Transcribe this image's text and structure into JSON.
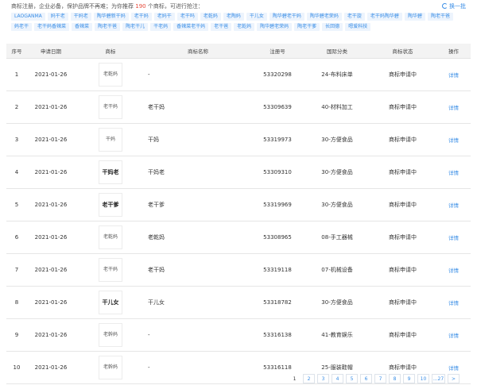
{
  "header": {
    "notice_prefix": "商标注册，企业必备，保护品牌不再难；为你推荐",
    "notice_count": "190",
    "notice_suffix": "个商标，可进行抢注：",
    "refresh_label": "换一批"
  },
  "tags": [
    [
      "LAOGANMA",
      "妈干老",
      "干妈老",
      "陶华碧新干妈",
      "老干妈",
      "老妈干",
      "老干吗",
      "老乾妈",
      "老陶妈",
      "干儿女",
      "陶华碧老干妈",
      "陶华碧老荣妈",
      "老干旋",
      "老干妈陶华碧",
      "陶华碧",
      "陶老干爸"
    ],
    [
      "妈老干",
      "老干妈香辣菜",
      "香辣菜",
      "陶老干爸",
      "陶老干儿",
      "干老妈",
      "香辣菜老干妈",
      "老干爸",
      "老乾妈",
      "陶华碧老荣妈",
      "陶老干爹",
      "长回德",
      "嗯爱科技"
    ]
  ],
  "table": {
    "columns": [
      "序号",
      "申请日期",
      "商标",
      "商标名称",
      "注册号",
      "国际分类",
      "商标状态",
      "操作"
    ],
    "rows": [
      {
        "idx": "1",
        "date": "2021-01-26",
        "logo": "老乾妈",
        "name": "-",
        "reg": "53320298",
        "cls": "24-布料床单",
        "status": "商标申请中",
        "op": "详情"
      },
      {
        "idx": "2",
        "date": "2021-01-26",
        "logo": "老干妈",
        "name": "老干妈",
        "reg": "53309639",
        "cls": "40-材料加工",
        "status": "商标申请中",
        "op": "详情"
      },
      {
        "idx": "3",
        "date": "2021-01-26",
        "logo": "干妈",
        "name": "干妈",
        "reg": "53319973",
        "cls": "30-方便食品",
        "status": "商标申请中",
        "op": "详情"
      },
      {
        "idx": "4",
        "date": "2021-01-26",
        "logo": "干妈老",
        "name": "干妈老",
        "reg": "53309310",
        "cls": "30-方便食品",
        "status": "商标申请中",
        "op": "详情"
      },
      {
        "idx": "5",
        "date": "2021-01-26",
        "logo": "老干爹",
        "name": "老干爹",
        "reg": "53319969",
        "cls": "30-方便食品",
        "status": "商标申请中",
        "op": "详情"
      },
      {
        "idx": "6",
        "date": "2021-01-26",
        "logo": "老乾妈",
        "name": "老乾妈",
        "reg": "53308965",
        "cls": "08-手工器械",
        "status": "商标申请中",
        "op": "详情"
      },
      {
        "idx": "7",
        "date": "2021-01-26",
        "logo": "老干妈",
        "name": "老干妈",
        "reg": "53319118",
        "cls": "07-机械设备",
        "status": "商标申请中",
        "op": "详情"
      },
      {
        "idx": "8",
        "date": "2021-01-26",
        "logo": "干儿女",
        "name": "干儿女",
        "reg": "53318782",
        "cls": "30-方便食品",
        "status": "商标申请中",
        "op": "详情"
      },
      {
        "idx": "9",
        "date": "2021-01-26",
        "logo": "老幹妈",
        "name": "-",
        "reg": "53316138",
        "cls": "41-教育娱乐",
        "status": "商标申请中",
        "op": "详情"
      },
      {
        "idx": "10",
        "date": "2021-01-26",
        "logo": "老幹妈",
        "name": "-",
        "reg": "53316118",
        "cls": "25-服装鞋帽",
        "status": "商标申请中",
        "op": "详情"
      }
    ]
  },
  "pager": {
    "pages": [
      "1",
      "2",
      "3",
      "4",
      "5",
      "6",
      "7",
      "8",
      "9",
      "10",
      "...27",
      ">"
    ],
    "current": "1"
  },
  "colors": {
    "accent": "#3a8ee6",
    "highlight": "#e64b3c",
    "header_bg": "#f3f3f3",
    "tag_bg": "#edf4fd"
  }
}
